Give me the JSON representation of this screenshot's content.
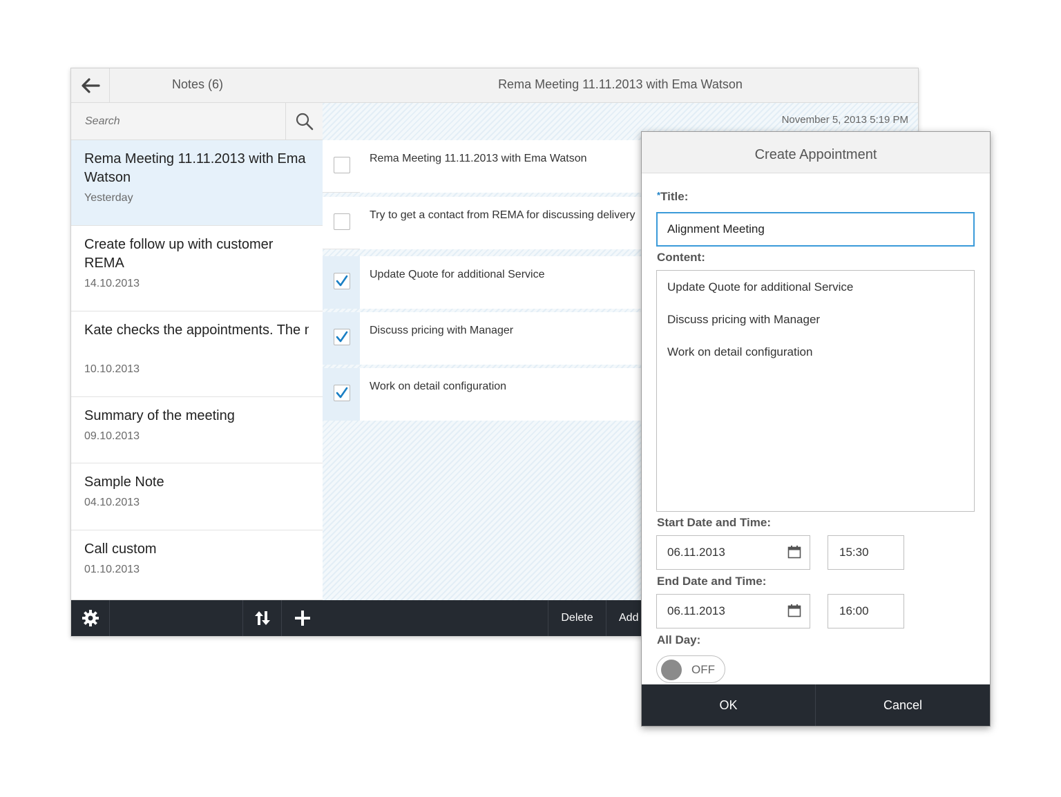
{
  "master": {
    "title": "Notes (6)",
    "search_placeholder": "Search",
    "notes": [
      {
        "title": "Rema Meeting 11.11.2013 with Ema Watson",
        "date": "Yesterday",
        "selected": true
      },
      {
        "title": "Create follow up with customer REMA",
        "date": "14.10.2013",
        "selected": false
      },
      {
        "title": "Kate checks the appointments. The note was created in the notes app.",
        "date": "10.10.2013",
        "selected": false
      },
      {
        "title": "Summary of the meeting",
        "date": "09.10.2013",
        "selected": false
      },
      {
        "title": "Sample Note",
        "date": "04.10.2013",
        "selected": false
      },
      {
        "title": "Call custom",
        "date": "01.10.2013",
        "selected": false
      }
    ],
    "footer": {
      "settings_icon": "gear-icon",
      "sort_icon": "sort-icon",
      "add_icon": "plus-icon"
    }
  },
  "detail": {
    "title": "Rema Meeting 11.11.2013 with Ema Watson",
    "timestamp": "November 5, 2013 5:19 PM",
    "todos": [
      {
        "text": "Rema Meeting 11.11.2013 with Ema Watson",
        "checked": false
      },
      {
        "text": "Try to get a contact from REMA for discussing delivery",
        "checked": false
      },
      {
        "text": "Update Quote for additional Service",
        "checked": true
      },
      {
        "text": "Discuss pricing with Manager",
        "checked": true
      },
      {
        "text": "Work on detail configuration",
        "checked": true
      }
    ],
    "footer": {
      "delete_label": "Delete",
      "add_label": "Add"
    }
  },
  "dialog": {
    "title": "Create Appointment",
    "required_mark": "*",
    "title_label": "Title:",
    "title_value": "Alignment Meeting",
    "content_label": "Content:",
    "content_lines": [
      "Update Quote for additional Service",
      "Discuss pricing with Manager",
      "Work on detail configuration"
    ],
    "start_label": "Start Date and Time:",
    "start_date": "06.11.2013",
    "start_time": "15:30",
    "end_label": "End Date and Time:",
    "end_date": "06.11.2013",
    "end_time": "16:00",
    "allday_label": "All Day:",
    "allday_state": "OFF",
    "ok_label": "OK",
    "cancel_label": "Cancel"
  },
  "colors": {
    "accent": "#1a7fc4",
    "footer_bg": "#252a31",
    "selected_bg": "#e6f1fa"
  }
}
